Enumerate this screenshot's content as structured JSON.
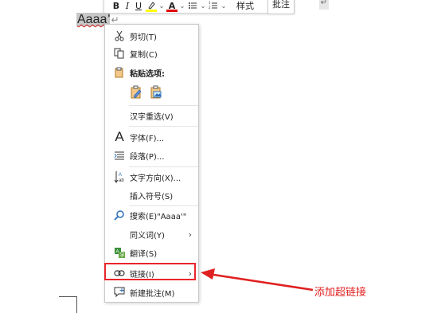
{
  "toolbar": {
    "bold": "B",
    "italic": "I",
    "underline": "U",
    "font_color": "A",
    "style_label": "样式",
    "comment_button": "批注",
    "highlight_color": "#ffff00",
    "font_color_bar": "#e00000"
  },
  "document": {
    "selected_text": "Aaaa",
    "trailing_quote": "'",
    "paragraph_mark": "↵"
  },
  "menu": {
    "cut": "剪切(T)",
    "copy": "复制(C)",
    "paste_options": "粘贴选项:",
    "reconvert": "汉字重选(V)",
    "font": "字体(F)...",
    "paragraph": "段落(P)...",
    "text_direction": "文字方向(X)...",
    "insert_symbol": "插入符号(S)",
    "search": "搜索(E)\"Aaaa'\"",
    "synonyms": "同义词(Y)",
    "translate": "翻译(S)",
    "link": "链接(I)",
    "new_comment": "新建批注(M)"
  },
  "annotation": {
    "text": "添加超链接",
    "color": "#e02020"
  }
}
